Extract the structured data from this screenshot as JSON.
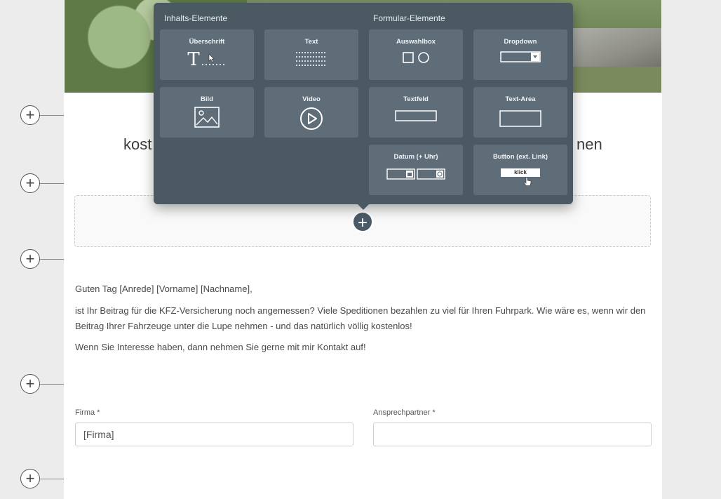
{
  "editor": {
    "headline_left": "kost",
    "headline_right": "nen",
    "greeting": "Guten Tag [Anrede] [Vorname] [Nachname],",
    "paragraph1": "ist Ihr Beitrag für die KFZ-Versicherung noch angemessen? Viele Speditionen bezahlen zu viel für Ihren Fuhrpark. Wie wäre es, wenn wir den Beitrag Ihrer Fahrzeuge unter die Lupe nehmen - und das natürlich völlig kostenlos!",
    "paragraph2": "Wenn Sie Interesse haben, dann nehmen Sie gerne mit mir Kontakt auf!",
    "add_symbol": "+",
    "form": {
      "firma_label": "Firma *",
      "firma_value": "[Firma]",
      "ansprechpartner_label": "Ansprechpartner *",
      "ansprechpartner_value": ""
    }
  },
  "popup": {
    "content_title": "Inhalts-Elemente",
    "form_title": "Formular-Elemente",
    "content_tiles": [
      {
        "label": "Überschrift",
        "icon": "heading-icon",
        "glyph": "T"
      },
      {
        "label": "Text",
        "icon": "text-icon"
      },
      {
        "label": "Bild",
        "icon": "image-icon"
      },
      {
        "label": "Video",
        "icon": "video-play-icon"
      }
    ],
    "form_tiles": [
      {
        "label": "Auswahlbox",
        "icon": "checkbox-radio-icon"
      },
      {
        "label": "Dropdown",
        "icon": "dropdown-icon"
      },
      {
        "label": "Textfeld",
        "icon": "textfield-icon"
      },
      {
        "label": "Text-Area",
        "icon": "textarea-icon"
      },
      {
        "label": "Datum (+ Uhr)",
        "icon": "date-time-icon"
      },
      {
        "label": "Button (ext. Link)",
        "icon": "button-link-icon",
        "button_text": "klick"
      }
    ]
  },
  "colors": {
    "popup_bg": "#4b5963",
    "tile_bg": "#5f6d78",
    "page_bg": "#ececec"
  }
}
